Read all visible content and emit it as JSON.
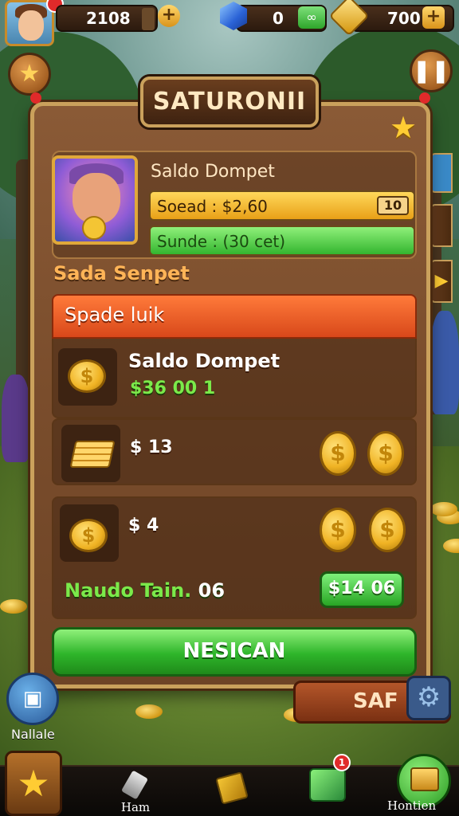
{
  "hud": {
    "xp_value": "2108",
    "gems_value": "0",
    "gold_value": "700",
    "plus_label": "+"
  },
  "panel": {
    "title": "SATURONII",
    "wallet": {
      "title": "Saldo Dompet",
      "yellow_bar_text": "Soead : $2,60",
      "yellow_bar_badge": "10",
      "green_bar_text": "Sunde : (30 cet)"
    },
    "section_label": "Sada Senpet",
    "red_header": "Spade luik",
    "rows": [
      {
        "title": "Saldo Dompet",
        "sub": "$36 00 1"
      },
      {
        "price": "$ 13"
      },
      {
        "price": "$ 4"
      }
    ],
    "coin_symbol": "$",
    "total_label": "Naudo Tain.",
    "total_value": "06",
    "price_button": "$14 06",
    "main_button": "NESICAN"
  },
  "side": {
    "sale_label": "SAF",
    "left_circle_label": "Nallale"
  },
  "nav": {
    "item2_label": "Ham",
    "item5_label": "Hontien",
    "notif_count": "1"
  },
  "colors": {
    "panel_brown": "#7a4d2c",
    "gold_border": "#caa15c",
    "accent_green": "#2eb52a",
    "accent_orange": "#d8481a",
    "coin_gold": "#f0b324"
  }
}
